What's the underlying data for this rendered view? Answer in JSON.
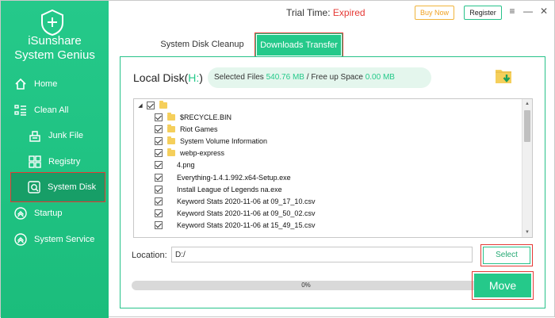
{
  "app": {
    "brand_line1": "iSunshare",
    "brand_line2": "System Genius"
  },
  "titlebar": {
    "trial_label": "Trial Time:",
    "trial_status": "Expired",
    "buy_label": "Buy Now",
    "register_label": "Register",
    "menu_glyph": "≡",
    "minimize_glyph": "—",
    "close_glyph": "✕"
  },
  "sidebar": {
    "items": [
      {
        "label": "Home",
        "icon": "home-icon"
      },
      {
        "label": "Clean All",
        "icon": "clean-all-icon"
      },
      {
        "label": "Junk File",
        "icon": "junk-file-icon"
      },
      {
        "label": "Registry",
        "icon": "registry-icon"
      },
      {
        "label": "System Disk",
        "icon": "system-disk-icon",
        "active": true
      },
      {
        "label": "Startup",
        "icon": "startup-icon"
      },
      {
        "label": "System Service",
        "icon": "system-service-icon"
      }
    ]
  },
  "tabs": [
    {
      "label": "System Disk Cleanup"
    },
    {
      "label": "Downloads Transfer",
      "active": true
    }
  ],
  "panel": {
    "disk_prefix": "Local Disk(",
    "disk_letter": "H:",
    "disk_suffix": ")",
    "selected_files_label": "Selected Files",
    "selected_files_value": "540.76 MB",
    "separator": "/",
    "free_up_label": "Free up Space",
    "free_up_value": "0.00 MB"
  },
  "tree": {
    "items": [
      {
        "name": "$RECYCLE.BIN",
        "type": "folder"
      },
      {
        "name": "Riot Games",
        "type": "folder"
      },
      {
        "name": "System Volume Information",
        "type": "folder"
      },
      {
        "name": "webp-express",
        "type": "folder"
      },
      {
        "name": "4.png",
        "type": "file"
      },
      {
        "name": "Everything-1.4.1.992.x64-Setup.exe",
        "type": "file"
      },
      {
        "name": "Install League of Legends na.exe",
        "type": "file"
      },
      {
        "name": "Keyword Stats 2020-11-06 at 09_17_10.csv",
        "type": "file"
      },
      {
        "name": "Keyword Stats 2020-11-06 at 09_50_02.csv",
        "type": "file"
      },
      {
        "name": "Keyword Stats 2020-11-06 at 15_49_15.csv",
        "type": "file"
      }
    ]
  },
  "location": {
    "label": "Location:",
    "value": "D:/",
    "select_label": "Select"
  },
  "progress": {
    "value": 0,
    "text": "0%"
  },
  "move_label": "Move",
  "colors": {
    "accent": "#25c98a",
    "highlight_border": "#e53935",
    "expired": "#e53935"
  }
}
